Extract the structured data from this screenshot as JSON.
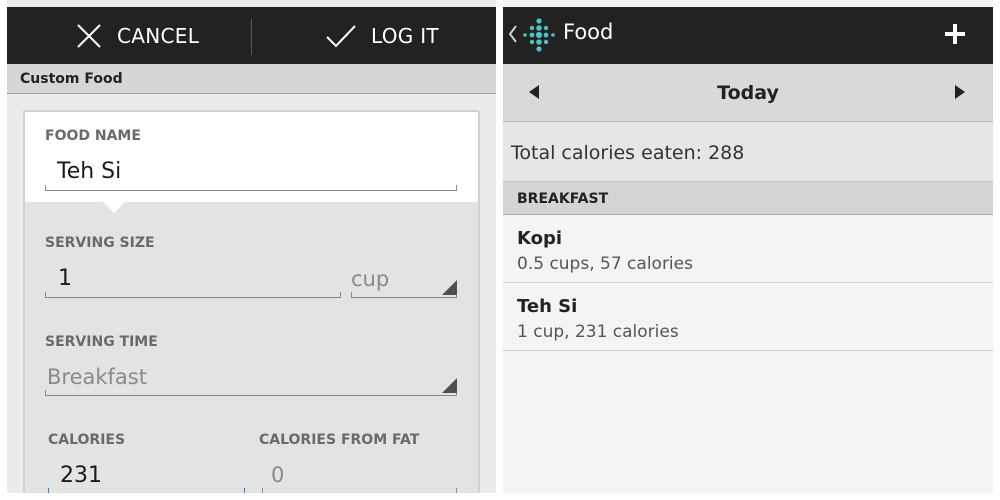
{
  "log_screen": {
    "actions": {
      "cancel_label": "CANCEL",
      "log_label": "LOG IT"
    },
    "section_title": "Custom Food",
    "form": {
      "food_name_label": "FOOD NAME",
      "food_name_value": "Teh Si",
      "serving_size_label": "SERVING SIZE",
      "serving_size_value": "1",
      "serving_unit": "cup",
      "serving_time_label": "SERVING TIME",
      "serving_time_value": "Breakfast",
      "calories_label": "CALORIES",
      "calories_value": "231",
      "calories_from_fat_label": "CALORIES FROM FAT",
      "calories_from_fat_value": "0"
    }
  },
  "food_screen": {
    "title": "Food",
    "date_label": "Today",
    "total_text": "Total calories eaten: 288",
    "meal_header": "BREAKFAST",
    "items": [
      {
        "name": "Kopi",
        "detail": "0.5 cups, 57 calories"
      },
      {
        "name": "Teh Si",
        "detail": "1 cup, 231 calories"
      }
    ]
  },
  "colors": {
    "action_bar": "#222222",
    "logo_teal": "#4cc2c4",
    "input_focus": "#3b7dc4"
  },
  "icons": [
    "close-icon",
    "check-icon",
    "back-chevron-icon",
    "fitbit-logo-icon",
    "plus-icon",
    "arrow-left-icon",
    "arrow-right-icon"
  ]
}
